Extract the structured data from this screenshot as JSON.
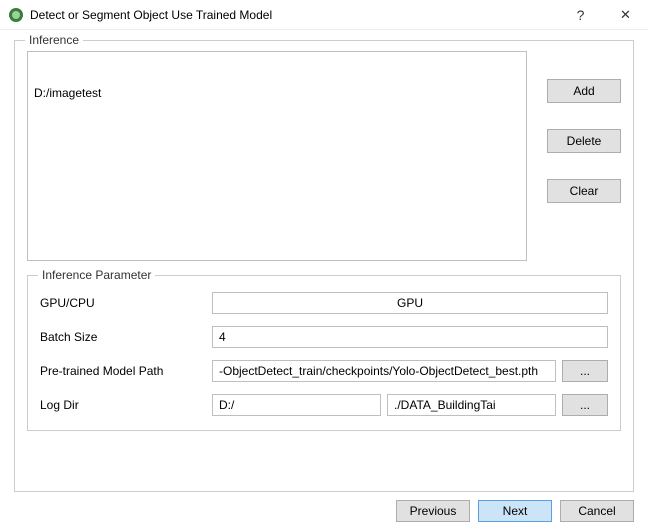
{
  "window": {
    "title": "Detect or Segment Object Use Trained Model",
    "help": "?",
    "close": "✕"
  },
  "inference": {
    "legend": "Inference",
    "items": [
      "D:/imagetest"
    ],
    "add": "Add",
    "delete": "Delete",
    "clear": "Clear"
  },
  "params": {
    "legend": "Inference Parameter",
    "gpu_label": "GPU/CPU",
    "gpu_value": "GPU",
    "batch_label": "Batch Size",
    "batch_value": "4",
    "model_label": "Pre-trained Model Path",
    "model_value": "-ObjectDetect_train/checkpoints/Yolo-ObjectDetect_best.pth",
    "logdir_label": "Log Dir",
    "logdir_prefix": "D:/",
    "logdir_value": "./DATA_BuildingTai",
    "browse": "..."
  },
  "footer": {
    "previous": "Previous",
    "next": "Next",
    "cancel": "Cancel"
  }
}
